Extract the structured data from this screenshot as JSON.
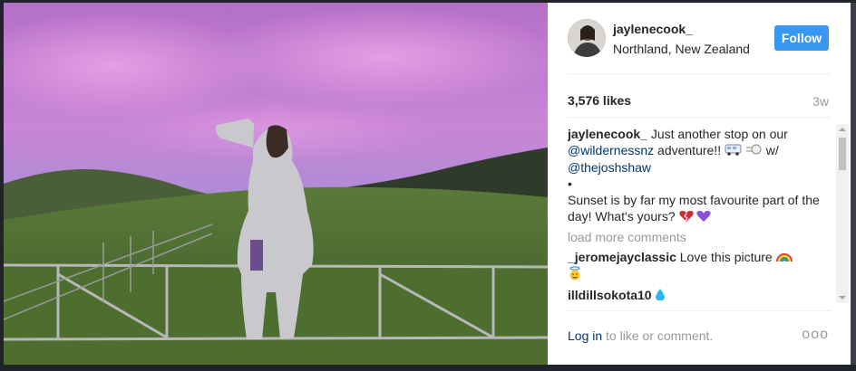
{
  "post": {
    "username": "jaylenecook_",
    "location": "Northland, New Zealand",
    "follow_label": "Follow",
    "likes": "3,576 likes",
    "time": "3w"
  },
  "caption": {
    "author": "jaylenecook_",
    "text1": "Just another stop on our",
    "mention1": "@wildernessnz",
    "text2": "adventure!!",
    "text3": "w/",
    "mention2": "@thejoshshaw",
    "bullet": "•",
    "text4": "Sunset is by far my most favourite part of the day! What's yours?"
  },
  "load_more": "load more comments",
  "comments": [
    {
      "user": "_jeromejayclassic",
      "text": "Love this picture"
    },
    {
      "user": "illdillsokota10",
      "text": ""
    }
  ],
  "footer": {
    "login_link": "Log in",
    "login_text": "to like or comment.",
    "more": "ooo"
  },
  "icons": {
    "van": "van-emoji-icon",
    "wind": "wind-emoji-icon",
    "heart_broken": "broken-heart-emoji-icon",
    "heart_purple": "purple-heart-emoji-icon",
    "rainbow": "rainbow-emoji-icon",
    "angel": "angel-emoji-icon",
    "drop": "droplet-emoji-icon"
  },
  "colors": {
    "follow_blue": "#3897f0",
    "link": "#003569",
    "muted": "#999999"
  }
}
